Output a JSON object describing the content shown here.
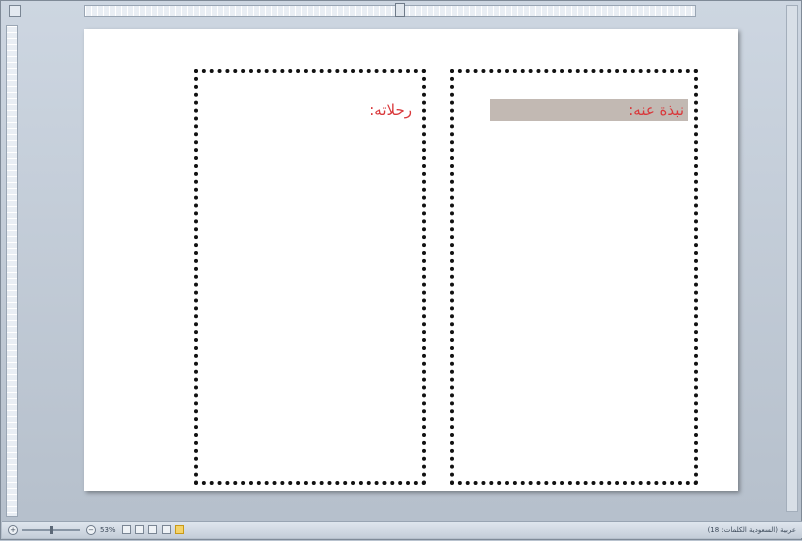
{
  "document": {
    "text_boxes": [
      {
        "id": "about",
        "label": "نبذة عنه:"
      },
      {
        "id": "trips",
        "label": "رحلاته:"
      }
    ]
  },
  "status_bar": {
    "zoom_level": "53%",
    "status_text": "(عربية (السعودية الكلمات: 18"
  },
  "colors": {
    "label_text": "#d9383b",
    "label_highlight": "#c2b9b3",
    "frame": "#b9c3cf"
  }
}
